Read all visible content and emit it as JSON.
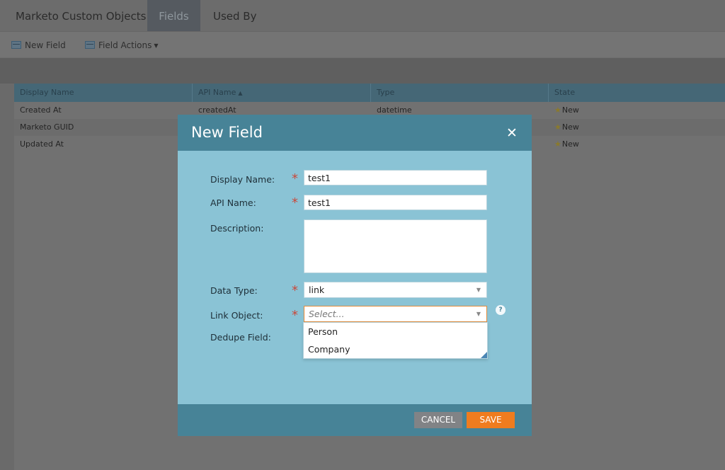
{
  "tabs": [
    {
      "label": "Marketo Custom Objects"
    },
    {
      "label": "Fields",
      "active": true
    },
    {
      "label": "Used By"
    }
  ],
  "toolbar": {
    "new_field_label": "New Field",
    "new_field_icon": "add-field-icon",
    "field_actions_label": "Field Actions",
    "field_actions_icon": "field-actions-icon"
  },
  "grid": {
    "columns": [
      "Display Name",
      "API Name",
      "Type",
      "State"
    ],
    "sort_indicator": "▲",
    "rows": [
      {
        "display_name": "Created At",
        "api_name": "createdAt",
        "type": "datetime",
        "state": "New"
      },
      {
        "display_name": "Marketo GUID",
        "api_name": "",
        "type": "",
        "state": "New"
      },
      {
        "display_name": "Updated At",
        "api_name": "",
        "type": "",
        "state": "New"
      }
    ]
  },
  "modal": {
    "title": "New Field",
    "close_icon": "close-icon",
    "labels": {
      "display_name": "Display Name:",
      "api_name": "API Name:",
      "description": "Description:",
      "data_type": "Data Type:",
      "link_object": "Link Object:",
      "dedupe_field": "Dedupe Field:"
    },
    "required_mark": "*",
    "values": {
      "display_name": "test1",
      "api_name": "test1",
      "description": "",
      "data_type": "link"
    },
    "link_object_placeholder": "Select...",
    "link_object_options": [
      "Person",
      "Company"
    ],
    "help_icon": "help-icon",
    "cancel_label": "CANCEL",
    "save_label": "SAVE"
  },
  "colors": {
    "modal_header": "#478397",
    "modal_body": "#8ac3d5",
    "required": "#c9493b",
    "save_button": "#ef7c1f",
    "cancel_button": "#818386"
  }
}
